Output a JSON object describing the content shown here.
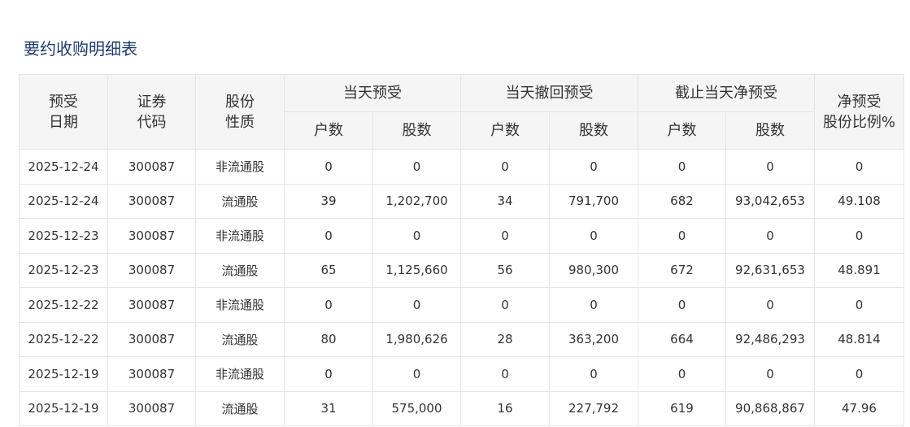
{
  "page_title": "要约收购明细表",
  "header": {
    "date": [
      "预受",
      "日期"
    ],
    "code": [
      "证券",
      "代码"
    ],
    "type": [
      "股份",
      "性质"
    ],
    "group_today": "当天预受",
    "group_withdraw": "当天撤回预受",
    "group_net": "截止当天净预受",
    "ratio": [
      "净预受",
      "股份比例%"
    ],
    "households": "户数",
    "shares": "股数"
  },
  "rows": [
    {
      "date": "2025-12-24",
      "code": "300087",
      "type": "非流通股",
      "today_hh": "0",
      "today_sh": "0",
      "wd_hh": "0",
      "wd_sh": "0",
      "net_hh": "0",
      "net_sh": "0",
      "ratio": "0"
    },
    {
      "date": "2025-12-24",
      "code": "300087",
      "type": "流通股",
      "today_hh": "39",
      "today_sh": "1,202,700",
      "wd_hh": "34",
      "wd_sh": "791,700",
      "net_hh": "682",
      "net_sh": "93,042,653",
      "ratio": "49.108"
    },
    {
      "date": "2025-12-23",
      "code": "300087",
      "type": "非流通股",
      "today_hh": "0",
      "today_sh": "0",
      "wd_hh": "0",
      "wd_sh": "0",
      "net_hh": "0",
      "net_sh": "0",
      "ratio": "0"
    },
    {
      "date": "2025-12-23",
      "code": "300087",
      "type": "流通股",
      "today_hh": "65",
      "today_sh": "1,125,660",
      "wd_hh": "56",
      "wd_sh": "980,300",
      "net_hh": "672",
      "net_sh": "92,631,653",
      "ratio": "48.891"
    },
    {
      "date": "2025-12-22",
      "code": "300087",
      "type": "非流通股",
      "today_hh": "0",
      "today_sh": "0",
      "wd_hh": "0",
      "wd_sh": "0",
      "net_hh": "0",
      "net_sh": "0",
      "ratio": "0"
    },
    {
      "date": "2025-12-22",
      "code": "300087",
      "type": "流通股",
      "today_hh": "80",
      "today_sh": "1,980,626",
      "wd_hh": "28",
      "wd_sh": "363,200",
      "net_hh": "664",
      "net_sh": "92,486,293",
      "ratio": "48.814"
    },
    {
      "date": "2025-12-19",
      "code": "300087",
      "type": "非流通股",
      "today_hh": "0",
      "today_sh": "0",
      "wd_hh": "0",
      "wd_sh": "0",
      "net_hh": "0",
      "net_sh": "0",
      "ratio": "0"
    },
    {
      "date": "2025-12-19",
      "code": "300087",
      "type": "流通股",
      "today_hh": "31",
      "today_sh": "575,000",
      "wd_hh": "16",
      "wd_sh": "227,792",
      "net_hh": "619",
      "net_sh": "90,868,867",
      "ratio": "47.96"
    }
  ],
  "colors": {
    "title": "#1f3a6e",
    "header_bg": "#f5f5f5",
    "border": "#e6e6e6",
    "text": "#333333"
  }
}
